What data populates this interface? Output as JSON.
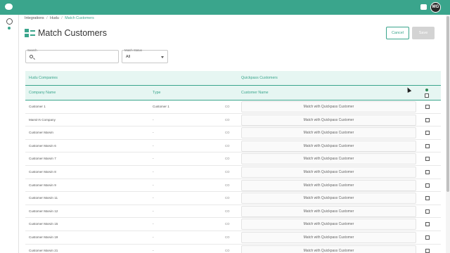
{
  "topbar": {
    "logo_icon": "chat-bubble-logo-icon",
    "chat_icon": "chat-icon",
    "avatar_initials": "MG"
  },
  "sidebar": {
    "items": [
      {
        "icon": "integrations-icon"
      },
      {
        "icon": "status-dot-icon"
      }
    ]
  },
  "breadcrumb": {
    "items": [
      "Integrations",
      "Hudu",
      "Match Customers"
    ],
    "separator": "/"
  },
  "page": {
    "title": "Match Customers",
    "cancel_label": "Cancel",
    "save_label": "Save"
  },
  "filters": {
    "search_label": "Search",
    "search_value": "",
    "status_label": "Match Status",
    "status_value": "All"
  },
  "table": {
    "group_left": "Hudu Companies",
    "group_right": "Quickpass Customers",
    "col_company": "Company Name",
    "col_type": "Type",
    "col_customer": "Customer Name",
    "rows": [
      {
        "name": "Customer 1",
        "type": "Customer 1",
        "code": "CO",
        "match": "Match with Quickpass Customer"
      },
      {
        "name": "Marvin's Company",
        "type": "-",
        "code": "CO",
        "match": "Match with Quickpass Customer"
      },
      {
        "name": "Customer Marvin",
        "type": "-",
        "code": "CO",
        "match": "Match with Quickpass Customer"
      },
      {
        "name": "Customer Marvin 6",
        "type": "-",
        "code": "CO",
        "match": "Match with Quickpass Customer"
      },
      {
        "name": "Customer Marvin 7",
        "type": "-",
        "code": "CO",
        "match": "Match with Quickpass Customer"
      },
      {
        "name": "Customer Marvin 8",
        "type": "-",
        "code": "CO",
        "match": "Match with Quickpass Customer"
      },
      {
        "name": "Customer Marvin 9",
        "type": "-",
        "code": "CO",
        "match": "Match with Quickpass Customer"
      },
      {
        "name": "Customer Marvin 11",
        "type": "-",
        "code": "CO",
        "match": "Match with Quickpass Customer"
      },
      {
        "name": "Customer Marvin 12",
        "type": "-",
        "code": "CO",
        "match": "Match with Quickpass Customer"
      },
      {
        "name": "Customer Marvin 15",
        "type": "-",
        "code": "CO",
        "match": "Match with Quickpass Customer"
      },
      {
        "name": "Customer Marvin 19",
        "type": "-",
        "code": "CO",
        "match": "Match with Quickpass Customer"
      },
      {
        "name": "Customer Marvin 21",
        "type": "-",
        "code": "CO",
        "match": "Match with Quickpass Customer"
      }
    ]
  },
  "colors": {
    "accent": "#3aa58c",
    "header_bg": "#e6f6f2",
    "save_disabled": "#d3d3d3"
  }
}
